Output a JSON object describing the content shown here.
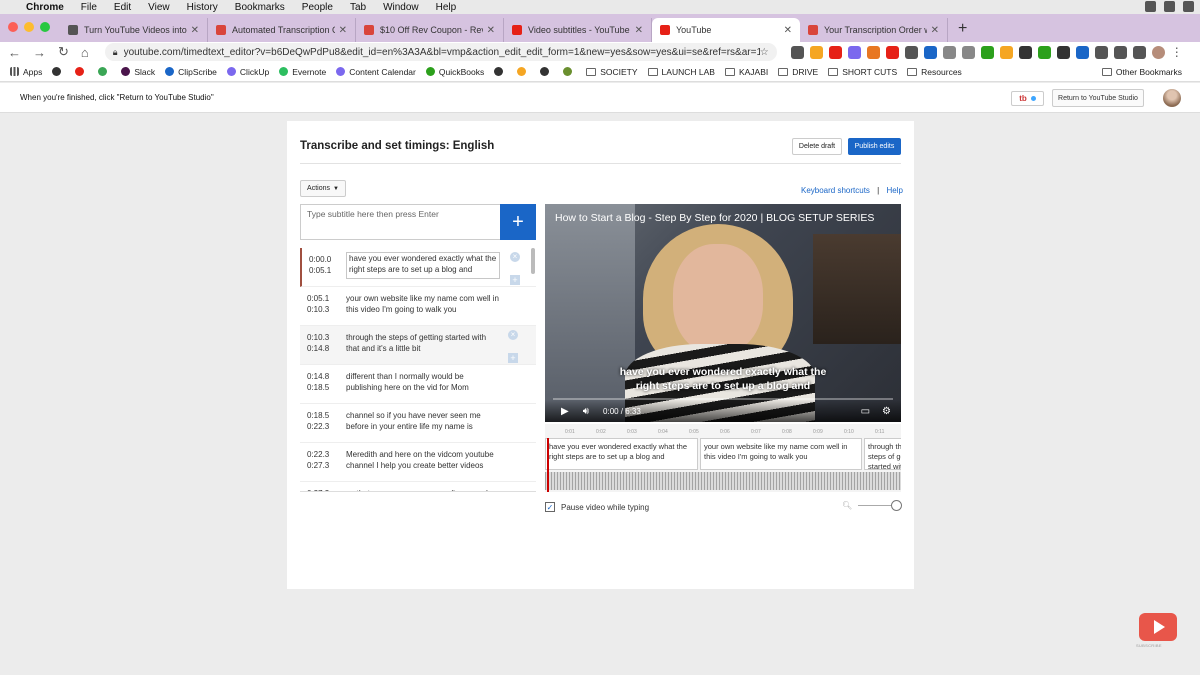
{
  "menubar": {
    "items": [
      "Chrome",
      "File",
      "Edit",
      "View",
      "History",
      "Bookmarks",
      "People",
      "Tab",
      "Window",
      "Help"
    ]
  },
  "tabs": [
    {
      "title": "Turn YouTube Videos into Blog P",
      "color": "#555555"
    },
    {
      "title": "Automated Transcription Checko",
      "color": "#d9453b"
    },
    {
      "title": "$10 Off Rev Coupon - Rev",
      "color": "#d9453b"
    },
    {
      "title": "Video subtitles - YouTube Studio",
      "color": "#e62117"
    },
    {
      "title": "YouTube",
      "color": "#e62117",
      "active": true
    },
    {
      "title": "Your Transcription Order was Re",
      "color": "#d9453b"
    }
  ],
  "address": {
    "url": "youtube.com/timedtext_editor?v=b6DeQwPdPu8&edit_id=en%3A3A&bl=vmp&action_edit_edit_form=1&new=yes&sow=yes&ui=se&ref=rs&ar=15868810520..."
  },
  "bookmarks": {
    "items": [
      {
        "label": "Apps",
        "kind": "grid",
        "color": "#555555"
      },
      {
        "label": "",
        "kind": "icon",
        "color": "#333333"
      },
      {
        "label": "",
        "kind": "icon",
        "color": "#e62117"
      },
      {
        "label": "",
        "kind": "icon",
        "color": "#3aa655"
      },
      {
        "label": "Slack",
        "kind": "icon",
        "color": "#4a154b"
      },
      {
        "label": "ClipScribe",
        "kind": "icon",
        "color": "#1a66c7"
      },
      {
        "label": "ClickUp",
        "kind": "icon",
        "color": "#7b68ee"
      },
      {
        "label": "Evernote",
        "kind": "icon",
        "color": "#2dbe60"
      },
      {
        "label": "Content Calendar",
        "kind": "icon",
        "color": "#7b68ee"
      },
      {
        "label": "QuickBooks",
        "kind": "icon",
        "color": "#2ca01c"
      },
      {
        "label": "",
        "kind": "icon",
        "color": "#333333"
      },
      {
        "label": "",
        "kind": "icon",
        "color": "#f5a623"
      },
      {
        "label": "",
        "kind": "icon",
        "color": "#333333"
      },
      {
        "label": "",
        "kind": "icon",
        "color": "#6a8f2f"
      },
      {
        "label": "SOCIETY",
        "kind": "folder"
      },
      {
        "label": "LAUNCH LAB",
        "kind": "folder"
      },
      {
        "label": "KAJABI",
        "kind": "folder"
      },
      {
        "label": "DRIVE",
        "kind": "folder"
      },
      {
        "label": "SHORT CUTS",
        "kind": "folder"
      },
      {
        "label": "Resources",
        "kind": "folder"
      }
    ],
    "other": "Other Bookmarks"
  },
  "studio": {
    "message": "When you're finished, click \"Return to YouTube Studio\"",
    "badge": "tb",
    "return_label": "Return to YouTube Studio"
  },
  "editor": {
    "title": "Transcribe and set timings: English",
    "delete_label": "Delete draft",
    "publish_label": "Publish edits",
    "actions_label": "Actions",
    "shortcuts_label": "Keyboard shortcuts",
    "separator": "|",
    "help_label": "Help",
    "input_placeholder": "Type subtitle here then press Enter",
    "plus": "+",
    "pause_label": "Pause video while typing",
    "subtitles": [
      {
        "start": "0:00.0",
        "end": "0:05.1",
        "text": "have you ever wondered exactly what the right steps are to set up a blog and"
      },
      {
        "start": "0:05.1",
        "end": "0:10.3",
        "text": "your own website like my name com well in this video I'm going to walk you"
      },
      {
        "start": "0:10.3",
        "end": "0:14.8",
        "text": "through the steps of getting started with that and it's a little bit"
      },
      {
        "start": "0:14.8",
        "end": "0:18.5",
        "text": "different than I normally would be publishing here on the vid for Mom"
      },
      {
        "start": "0:18.5",
        "end": "0:22.3",
        "text": "channel so if you have never seen me before in your entire life my name is"
      },
      {
        "start": "0:22.3",
        "end": "0:27.3",
        "text": "Meredith and here on the vidcom youtube channel I help you create better videos"
      },
      {
        "start": "0:27.3",
        "end": "",
        "text": "so that you can grow your audience and"
      }
    ]
  },
  "video": {
    "title": "How to Start a Blog - Step By Step for 2020 | BLOG SETUP SERIES",
    "caption_line1": "have you ever wondered exactly what the",
    "caption_line2": "right steps are to set up a blog and",
    "time": "0:00 / 6:33"
  },
  "timeline": {
    "ticks": [
      "0:01",
      "0:02",
      "0:03",
      "0:04",
      "0:05",
      "0:06",
      "0:07",
      "0:08",
      "0:09",
      "0:10",
      "0:11"
    ],
    "segments": [
      "have you ever wondered exactly what the right steps are to set up a blog and",
      "your own website like my name com well in this video I'm going to walk you",
      "through the steps of getting started with that and"
    ]
  },
  "subscribe_label": "SUBSCRIBE"
}
